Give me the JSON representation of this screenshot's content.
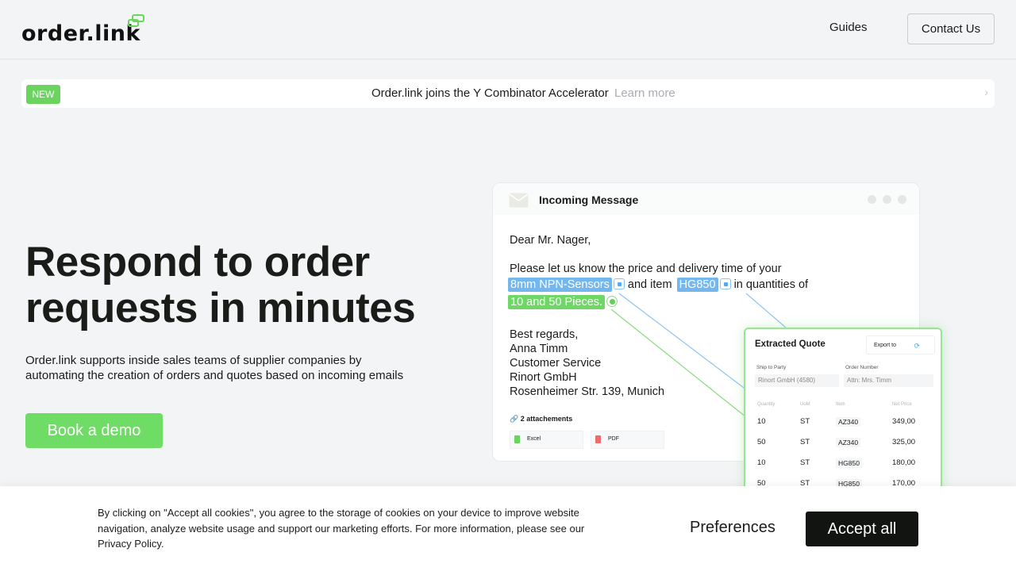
{
  "header": {
    "logo_text": "order.link",
    "nav_guides": "Guides",
    "contact_label": "Contact Us"
  },
  "announcement": {
    "badge": "NEW",
    "text": "Order.link joins the Y Combinator Accelerator",
    "link": "Learn more"
  },
  "hero": {
    "title_line1": "Respond to order",
    "title_line2": "requests in minutes",
    "subtitle_line1": "Order.link supports inside sales teams of supplier companies by",
    "subtitle_line2": "automating the creation of orders and quotes based on incoming emails",
    "cta": "Book a demo"
  },
  "message": {
    "title": "Incoming Message",
    "greeting": "Dear Mr. Nager,",
    "line1": "Please let us know the price and delivery time of your",
    "tag1": "8mm NPN-Sensors",
    "mid1": "and item",
    "tag2": "HG850",
    "mid2": "in quantities of",
    "tag3": "10 and 50 Pieces.",
    "sign1": "Best regards,",
    "sign2": "Anna Timm",
    "sign3": "Customer Service",
    "sign4": "Rinort GmbH",
    "sign5": "Rosenheimer Str. 139, Munich",
    "attachments_label": "2 attachements",
    "attachments": [
      "Excel",
      "PDF"
    ]
  },
  "quote": {
    "title": "Extracted Quote",
    "export": "Export to",
    "ship_label": "Ship to Party",
    "ship_value": "Rinort GmbH (4580)",
    "order_label": "Order Number",
    "order_value": "Attn: Mrs. Timm",
    "columns": [
      "Quantity",
      "UoM",
      "Item",
      "Net Price"
    ],
    "rows": [
      [
        "10",
        "ST",
        "AZ340",
        "349,00"
      ],
      [
        "50",
        "ST",
        "AZ340",
        "325,00"
      ],
      [
        "10",
        "ST",
        "HG850",
        "180,00"
      ],
      [
        "50",
        "ST",
        "HG850",
        "170,00"
      ]
    ]
  },
  "cookie": {
    "line1": "By clicking on \"Accept all cookies\", you agree to the storage of cookies on your device to improve website",
    "line2": "navigation, analyze website usage and support our marketing efforts. For more information, please see our",
    "line3": "Privacy Policy.",
    "preferences": "Preferences",
    "accept": "Accept all"
  },
  "colors": {
    "brand_green": "#6fdc66",
    "highlight_blue": "#73b7ee",
    "dark": "#121412"
  }
}
